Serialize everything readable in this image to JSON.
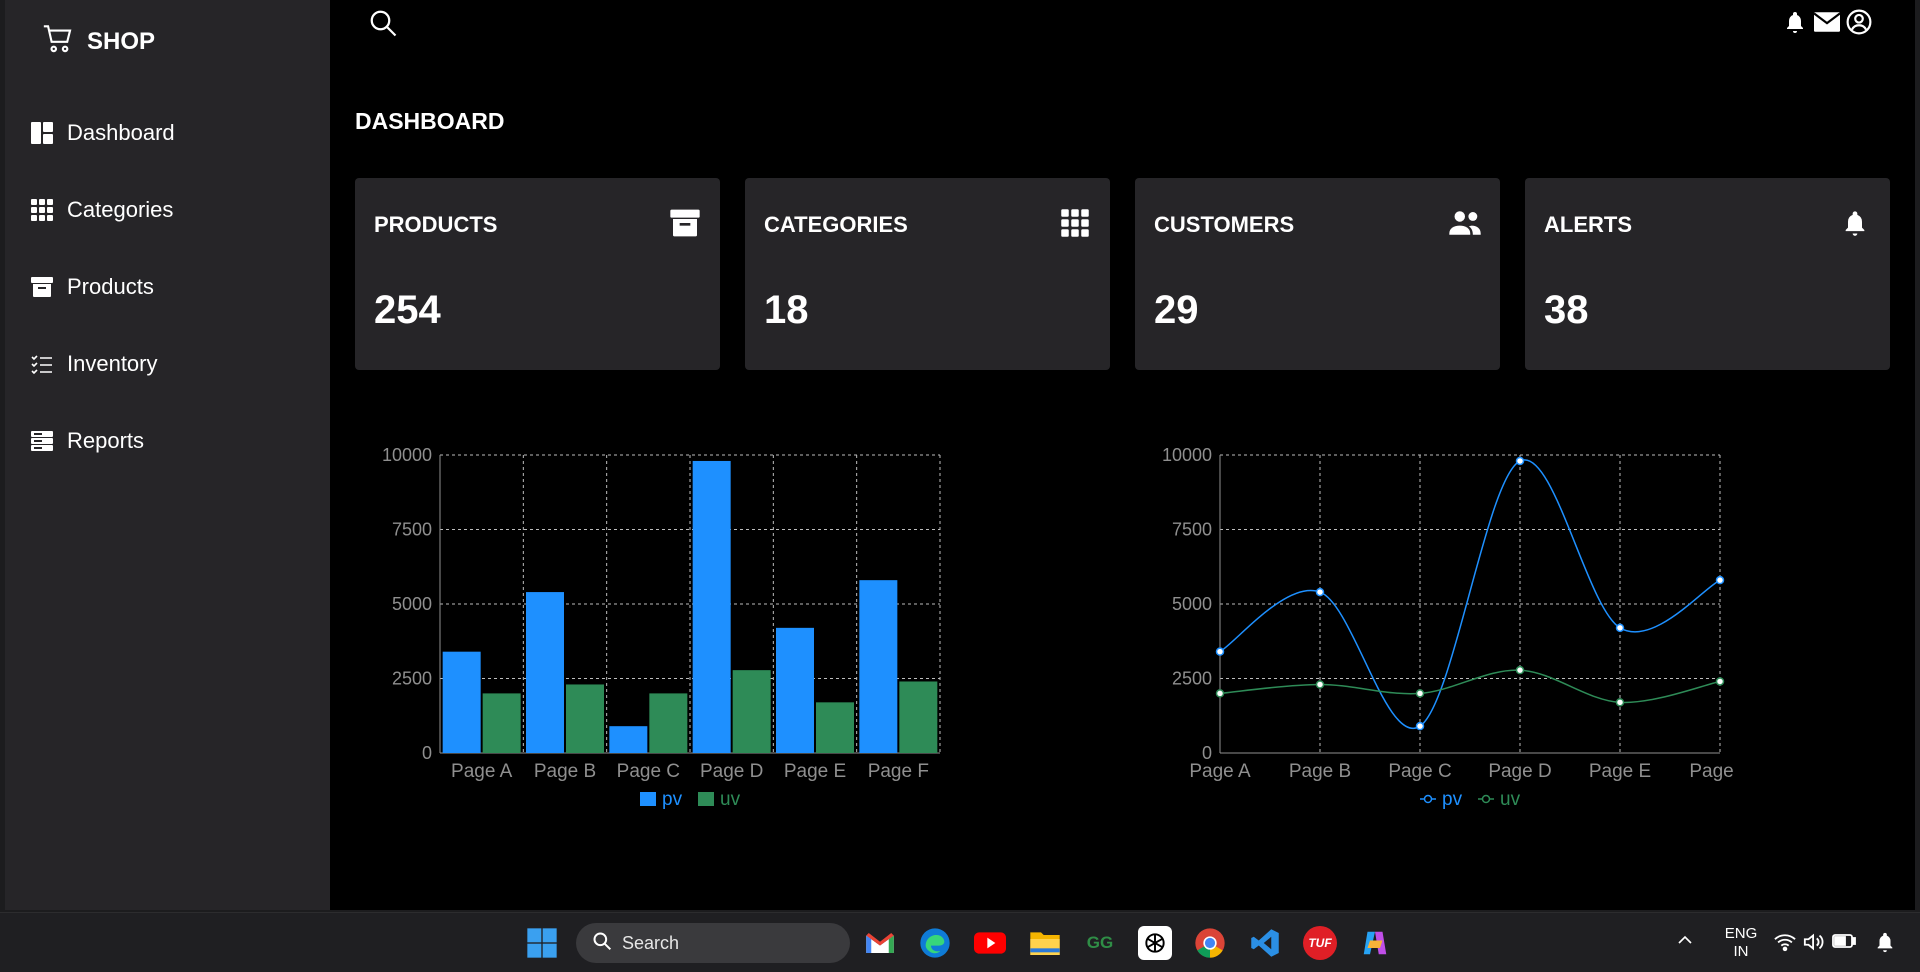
{
  "brand": {
    "label": "SHOP"
  },
  "sidebar": {
    "items": [
      {
        "label": "Dashboard",
        "icon": "dashboard-icon"
      },
      {
        "label": "Categories",
        "icon": "grid-icon"
      },
      {
        "label": "Products",
        "icon": "archive-icon"
      },
      {
        "label": "Inventory",
        "icon": "checklist-icon"
      },
      {
        "label": "Reports",
        "icon": "report-icon"
      }
    ]
  },
  "header": {
    "icons": [
      "search-icon",
      "bell-icon",
      "mail-icon",
      "user-icon"
    ]
  },
  "page": {
    "title": "DASHBOARD"
  },
  "cards": [
    {
      "title": "PRODUCTS",
      "value": "254",
      "icon": "archive-icon"
    },
    {
      "title": "CATEGORIES",
      "value": "18",
      "icon": "grid-icon"
    },
    {
      "title": "CUSTOMERS",
      "value": "29",
      "icon": "users-icon"
    },
    {
      "title": "ALERTS",
      "value": "38",
      "icon": "bell-icon"
    }
  ],
  "chart_data": [
    {
      "type": "bar",
      "categories": [
        "Page A",
        "Page B",
        "Page C",
        "Page D",
        "Page E",
        "Page F"
      ],
      "series": [
        {
          "name": "pv",
          "values": [
            3400,
            5400,
            900,
            9800,
            4200,
            5800
          ],
          "color": "#1e90ff"
        },
        {
          "name": "uv",
          "values": [
            2000,
            2300,
            2000,
            2780,
            1700,
            2400
          ],
          "color": "#2e8b57"
        }
      ],
      "yticks": [
        "0",
        "2500",
        "5000",
        "7500",
        "10000"
      ],
      "ylim": [
        0,
        10000
      ],
      "grid": true,
      "legend": "bottom"
    },
    {
      "type": "line",
      "categories": [
        "Page A",
        "Page B",
        "Page C",
        "Page D",
        "Page E",
        "Page F"
      ],
      "series": [
        {
          "name": "pv",
          "values": [
            3400,
            5400,
            900,
            9800,
            4200,
            5800
          ],
          "color": "#1e90ff"
        },
        {
          "name": "uv",
          "values": [
            2000,
            2300,
            2000,
            2780,
            1700,
            2400
          ],
          "color": "#2e8b57"
        }
      ],
      "yticks": [
        "0",
        "2500",
        "5000",
        "7500",
        "10000"
      ],
      "ylim": [
        0,
        10000
      ],
      "grid": true,
      "legend": "bottom"
    }
  ],
  "taskbar": {
    "search_label": "Search",
    "apps": [
      "windows-start-icon",
      "gmail-icon",
      "edge-icon",
      "youtube-icon",
      "file-explorer-icon",
      "geeksforgeeks-icon",
      "chatgpt-icon",
      "chrome-icon",
      "vscode-icon",
      "tuf-icon",
      "copilot-icon"
    ],
    "tuf_label": "TUF",
    "gfg_label": "GG",
    "lang_line1": "ENG",
    "lang_line2": "IN"
  }
}
